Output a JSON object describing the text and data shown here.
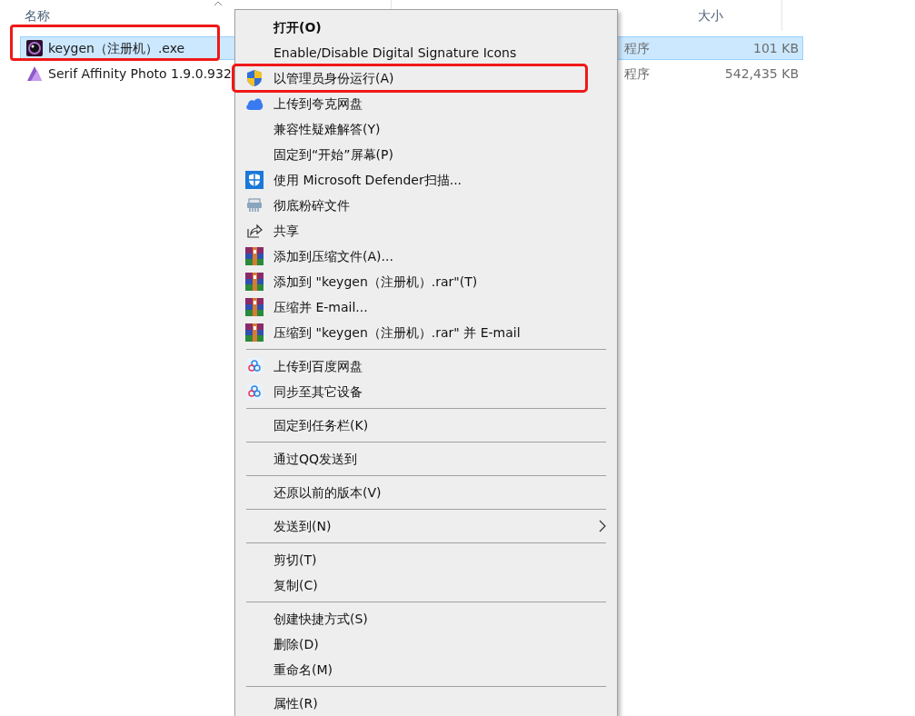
{
  "columns": [
    {
      "label": "名称",
      "kind": "name"
    },
    {
      "label": "大小",
      "kind": "size"
    }
  ],
  "files": [
    {
      "name": "keygen（注册机）.exe",
      "type": "程序",
      "size": "101 KB",
      "selected": true,
      "kind": "disc"
    },
    {
      "name": "Serif Affinity Photo 1.9.0.932",
      "type": "程序",
      "size": "542,435 KB",
      "selected": false,
      "kind": "triangle"
    }
  ],
  "context_menu": {
    "items": [
      {
        "kind": "plain",
        "label": "打开(O)",
        "bold": true
      },
      {
        "kind": "plain",
        "label": "Enable/Disable Digital Signature Icons"
      },
      {
        "kind": "shield",
        "label": "以管理员身份运行(A)",
        "highlighted": true
      },
      {
        "kind": "cloud",
        "label": "上传到夸克网盘"
      },
      {
        "kind": "plain",
        "label": "兼容性疑难解答(Y)"
      },
      {
        "kind": "plain",
        "label": "固定到“开始”屏幕(P)"
      },
      {
        "kind": "defender",
        "label": "使用 Microsoft Defender扫描..."
      },
      {
        "kind": "shredder",
        "label": "彻底粉碎文件"
      },
      {
        "kind": "share",
        "label": "共享"
      },
      {
        "kind": "archive",
        "label": "添加到压缩文件(A)..."
      },
      {
        "kind": "archive",
        "label": "添加到 \"keygen（注册机）.rar\"(T)"
      },
      {
        "kind": "archive",
        "label": "压缩并 E-mail..."
      },
      {
        "kind": "archive",
        "label": "压缩到 \"keygen（注册机）.rar\" 并 E-mail"
      },
      {
        "kind": "separator"
      },
      {
        "kind": "baidu",
        "label": "上传到百度网盘"
      },
      {
        "kind": "baidu",
        "label": "同步至其它设备"
      },
      {
        "kind": "separator"
      },
      {
        "kind": "plain",
        "label": "固定到任务栏(K)"
      },
      {
        "kind": "separator"
      },
      {
        "kind": "plain",
        "label": "通过QQ发送到"
      },
      {
        "kind": "separator"
      },
      {
        "kind": "plain",
        "label": "还原以前的版本(V)"
      },
      {
        "kind": "separator"
      },
      {
        "kind": "plain",
        "label": "发送到(N)",
        "submenu": true
      },
      {
        "kind": "separator"
      },
      {
        "kind": "plain",
        "label": "剪切(T)"
      },
      {
        "kind": "plain",
        "label": "复制(C)"
      },
      {
        "kind": "separator"
      },
      {
        "kind": "plain",
        "label": "创建快捷方式(S)"
      },
      {
        "kind": "plain",
        "label": "删除(D)"
      },
      {
        "kind": "plain",
        "label": "重命名(M)"
      },
      {
        "kind": "separator"
      },
      {
        "kind": "plain",
        "label": "属性(R)"
      }
    ]
  }
}
